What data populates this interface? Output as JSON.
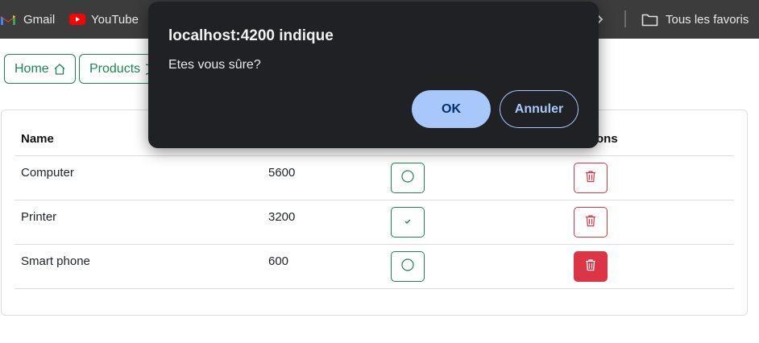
{
  "bookmarks": {
    "items": [
      {
        "label": "Gmail",
        "icon": "gmail-icon"
      },
      {
        "label": "YouTube",
        "icon": "youtube-icon"
      }
    ],
    "overflow_icon": "chevron-right-icon",
    "all_bookmarks_label": "Tous les favoris"
  },
  "nav": {
    "home_label": "Home",
    "products_label": "Products"
  },
  "table": {
    "headers": [
      "Name",
      "",
      "",
      "ons"
    ],
    "rows": [
      {
        "name": "Computer",
        "price": "5600",
        "checked": false,
        "delete_active": false
      },
      {
        "name": "Printer",
        "price": "3200",
        "checked": true,
        "delete_active": false
      },
      {
        "name": "Smart phone",
        "price": "600",
        "checked": false,
        "delete_active": true
      }
    ]
  },
  "dialog": {
    "title": "localhost:4200 indique",
    "message": "Etes vous sûre?",
    "ok_label": "OK",
    "cancel_label": "Annuler"
  },
  "colors": {
    "success": "#198754",
    "danger": "#dc3545",
    "dialog_bg": "#202124",
    "dialog_accent": "#a8c7fa",
    "bookmarks_bg": "#3c3c3c"
  }
}
